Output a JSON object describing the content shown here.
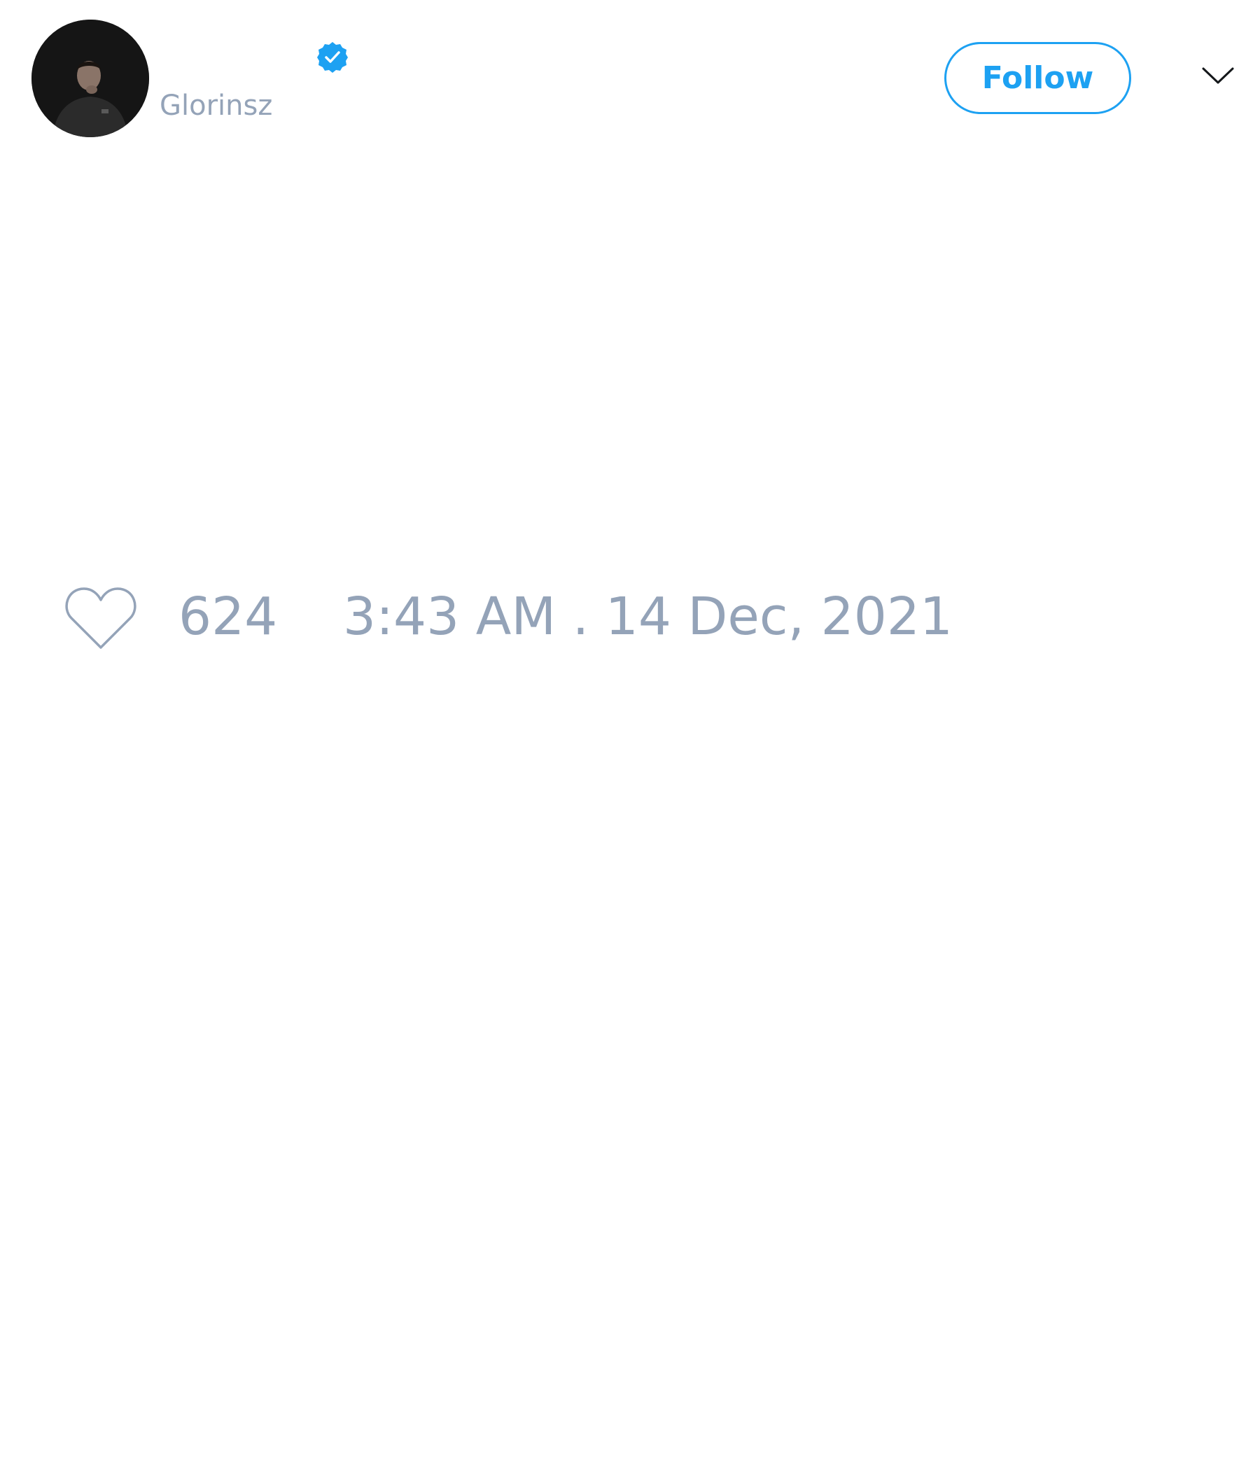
{
  "author": {
    "display_name": "",
    "handle": "Glorinsz",
    "verified": true
  },
  "header": {
    "follow_label": "Follow"
  },
  "tweet": {
    "like_count": "624",
    "timestamp": "3:43 AM . 14 Dec, 2021"
  },
  "icons": {
    "verified": "verified-badge-icon",
    "menu": "chevron-down-icon",
    "like": "heart-icon"
  },
  "colors": {
    "accent": "#1da1f2",
    "muted_text": "#94a3b8"
  }
}
